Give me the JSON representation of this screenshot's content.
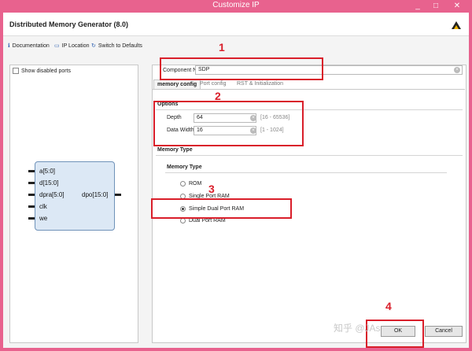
{
  "window": {
    "title": "Customize IP",
    "minimize": "_",
    "maximize": "□",
    "close": "✕"
  },
  "header": {
    "title": "Distributed Memory Generator (8.0)"
  },
  "toolbar": {
    "documentation": "Documentation",
    "ip_location": "IP Location",
    "switch_defaults": "Switch to Defaults"
  },
  "left": {
    "show_disabled_ports": "Show disabled ports",
    "ports_left": [
      "a[5:0]",
      "d[15:0]",
      "dpra[5:0]",
      "clk",
      "we"
    ],
    "port_right": "dpo[15:0]"
  },
  "component": {
    "label": "Component Name",
    "value": "SDP"
  },
  "tabs": [
    "memory config",
    "Port config",
    "RST & Initialization"
  ],
  "options": {
    "heading": "Options",
    "depth_label": "Depth",
    "depth_value": "64",
    "depth_range": "[16 - 65536]",
    "width_label": "Data Width",
    "width_value": "16",
    "width_range": "[1 - 1024]"
  },
  "memory_type": {
    "heading": "Memory Type",
    "subheading": "Memory Type",
    "items": [
      "ROM",
      "Single Port RAM",
      "Simple Dual Port RAM",
      "Dual Port RAM"
    ],
    "selected": "Simple Dual Port RAM"
  },
  "annotations": [
    "1",
    "2",
    "3",
    "4"
  ],
  "buttons": {
    "ok": "OK",
    "cancel": "Cancel"
  },
  "watermark": "知乎 @JAsper",
  "colors": {
    "annotation_red": "#d91e2a",
    "window_frame": "#e8628e",
    "symbol_fill": "#dce8f5"
  }
}
